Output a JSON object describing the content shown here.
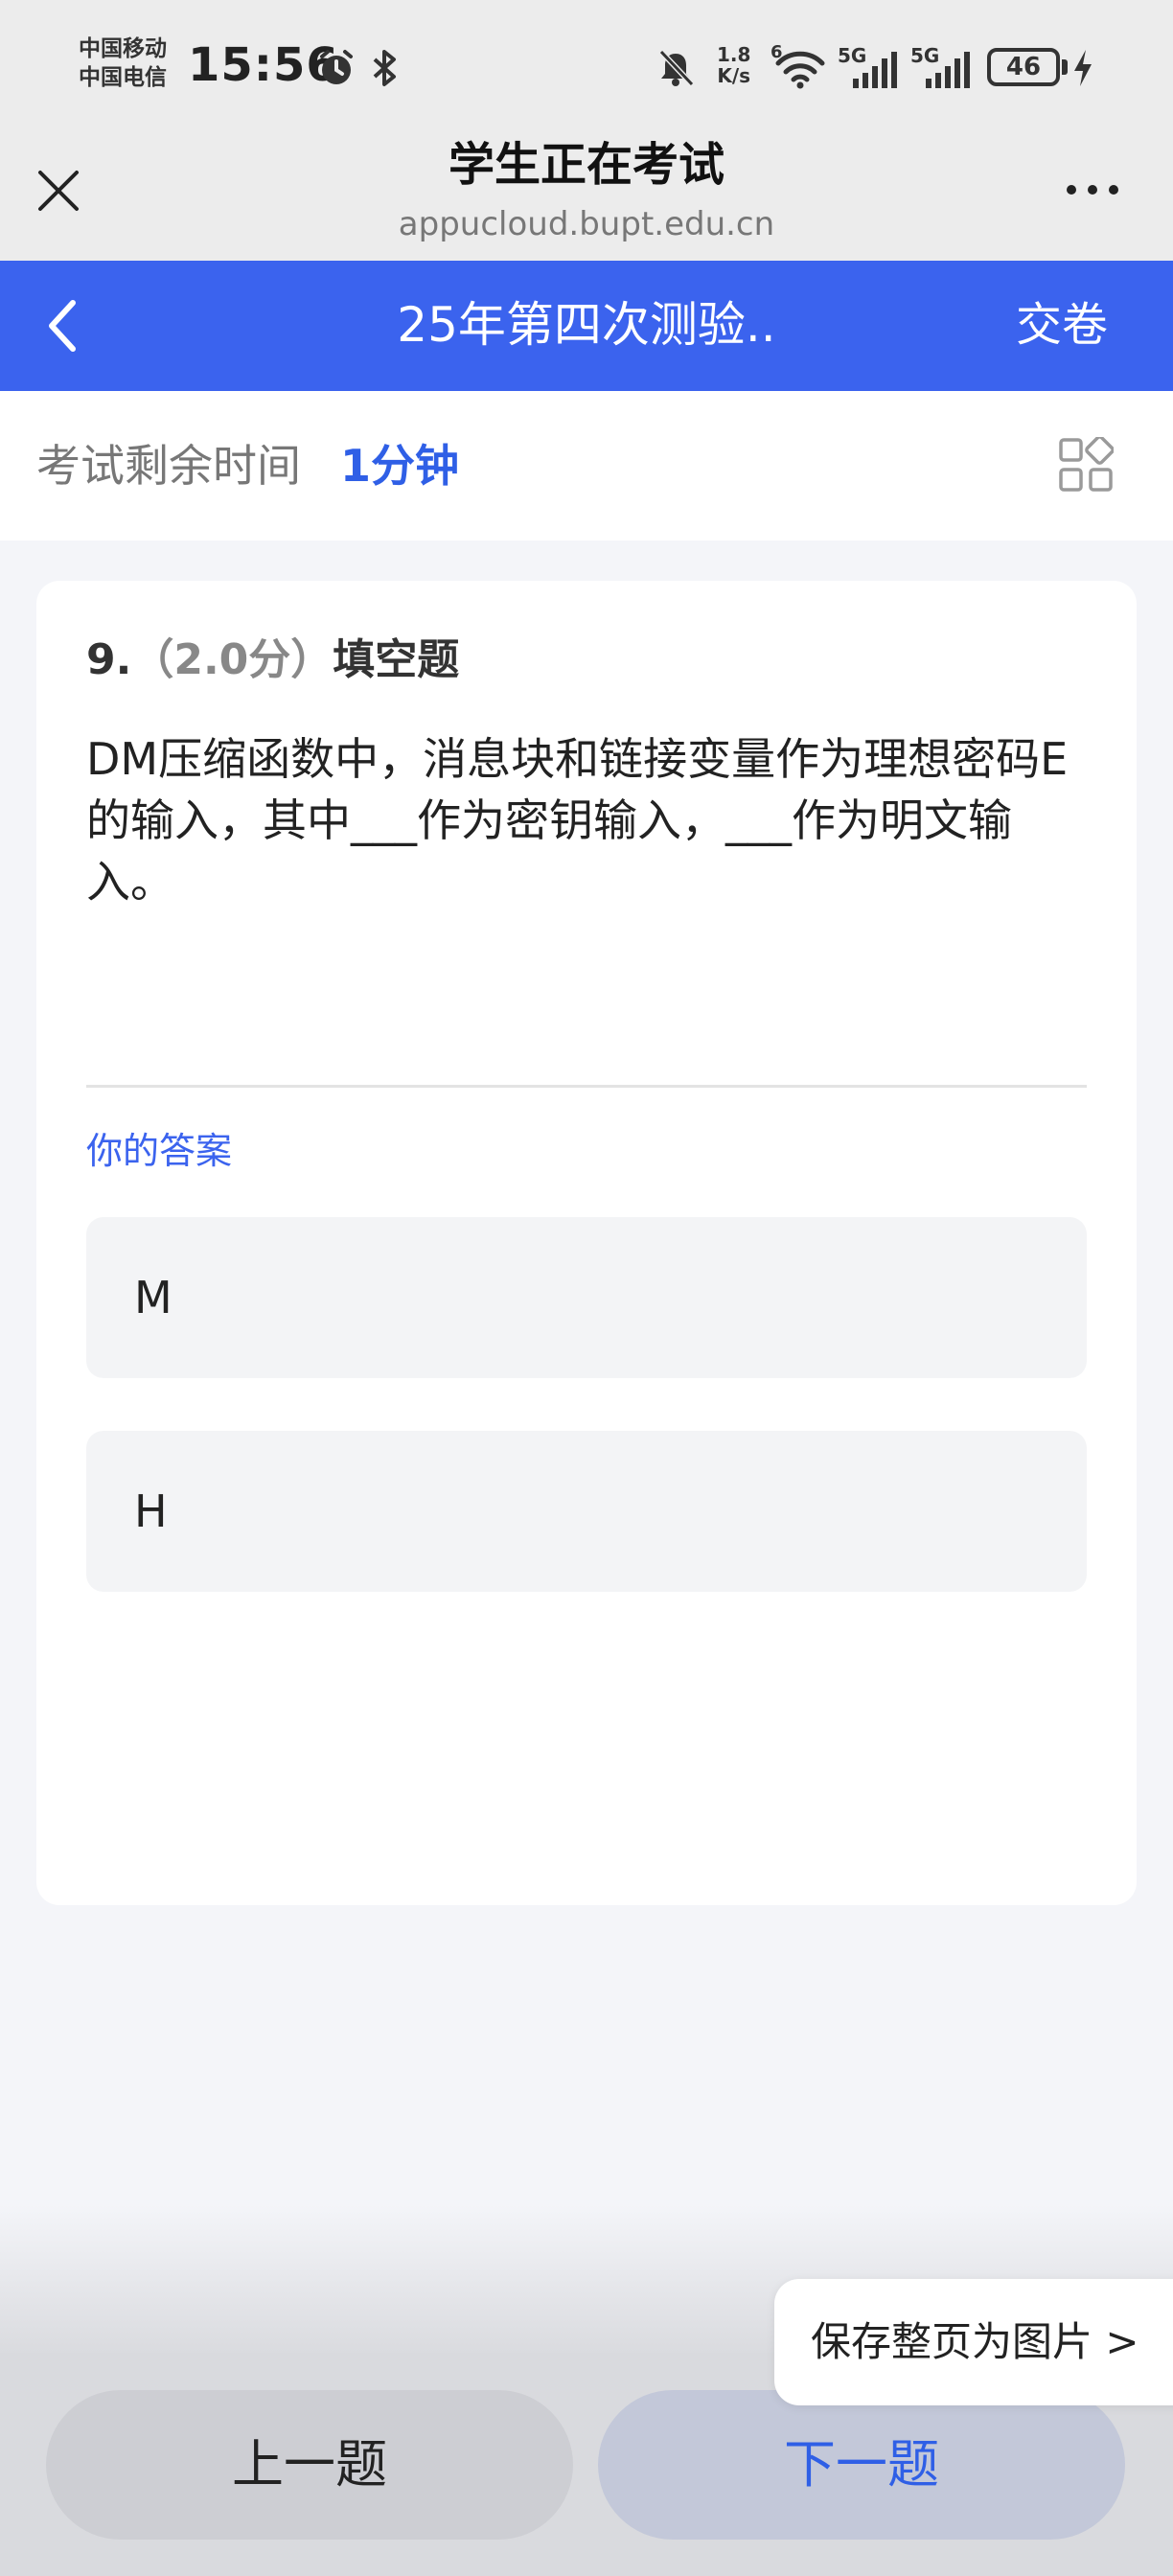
{
  "status_bar": {
    "carrier_1": "中国移动",
    "carrier_2": "中国电信",
    "time": "15:56",
    "net_speed_value": "1.8",
    "net_speed_unit": "K/s",
    "signal_1_label": "5G",
    "signal_2_label": "5G",
    "wifi_label": "6",
    "battery_level": "46",
    "icons": [
      "alarm-icon",
      "bluetooth-icon",
      "mute-bell-icon",
      "wifi-icon",
      "signal-icon",
      "charging-icon"
    ]
  },
  "browser": {
    "title": "学生正在考试",
    "url": "appucloud.bupt.edu.cn",
    "close_icon": "close-icon",
    "more_icon": "more-icon"
  },
  "exam_header": {
    "title": "25年第四次测验..",
    "submit_label": "交卷",
    "back_icon": "chevron-left-icon",
    "color": "#3b63ee"
  },
  "timer": {
    "label": "考试剩余时间",
    "value": "1分钟",
    "grid_icon": "grid-icon"
  },
  "question": {
    "number": "9.",
    "score": "（2.0分）",
    "type": "填空题",
    "body": "DM压缩函数中，消息块和链接变量作为理想密码E的输入，其中___作为密钥输入，___作为明文输入。"
  },
  "answers": {
    "label": "你的答案",
    "items": [
      "M",
      "H"
    ]
  },
  "actions": {
    "save_image_label": "保存整页为图片 >",
    "prev_label": "上一题",
    "next_label": "下一题"
  },
  "colors": {
    "accent": "#3b63ee",
    "background": "#f4f5f9"
  }
}
